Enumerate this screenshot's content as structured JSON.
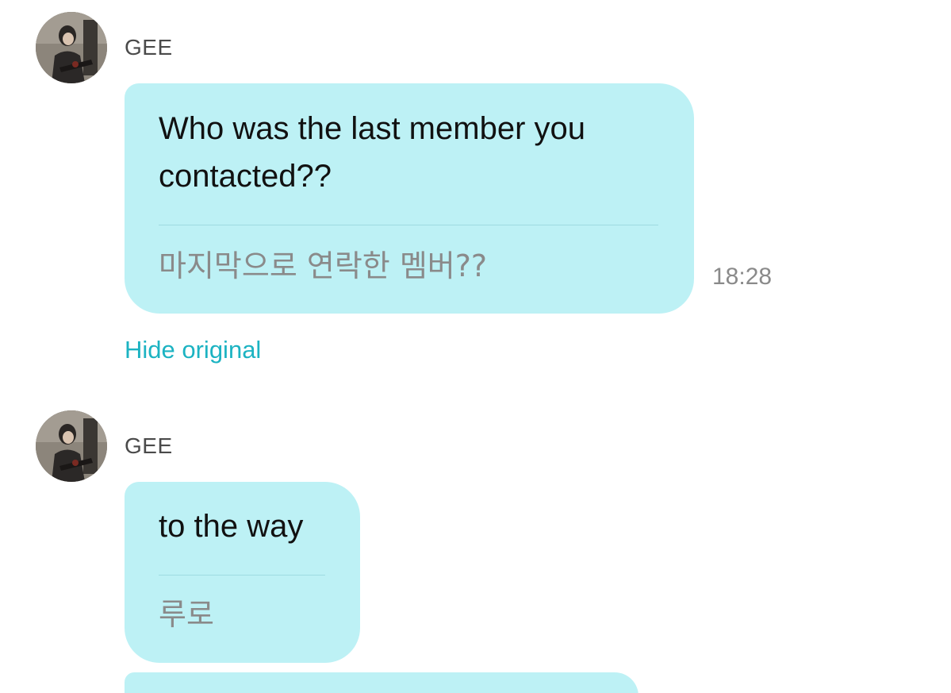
{
  "messages": [
    {
      "sender": "GEE",
      "translated_text": "Who was the last member you contacted??",
      "original_text": "마지막으로 연락한 멤버??",
      "time": "18:28",
      "toggle_label": "Hide original"
    },
    {
      "sender": "GEE",
      "translated_text": "to the way",
      "original_text": "루로"
    }
  ],
  "colors": {
    "bubble_bg": "#bdf1f5",
    "link": "#1cb3c2",
    "muted_text": "#8a8a8a"
  },
  "icons": {
    "avatar": "user-photo-avatar"
  }
}
